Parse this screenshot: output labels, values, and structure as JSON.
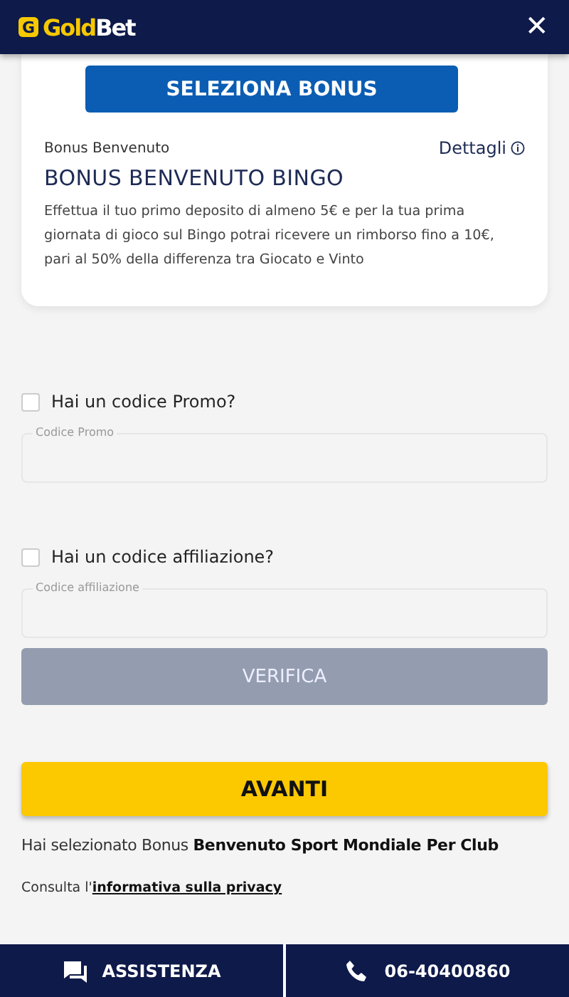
{
  "header": {
    "logo_badge": "G",
    "logo": [
      "Gold",
      "Bet"
    ],
    "close": "✕"
  },
  "bonus_card": {
    "button": "SELEZIONA BONUS",
    "category": "Bonus Benvenuto",
    "details_link": "Dettagli",
    "title": "BONUS BENVENUTO BINGO",
    "description": "Effettua il tuo primo deposito di almeno 5€ e per la tua prima giornata di gioco sul Bingo potrai ricevere un rimborso fino a 10€, pari al 50% della differenza tra Giocato e Vinto"
  },
  "codes": [
    {
      "label": "Hai un codice Promo?",
      "checked": false,
      "field_label": "Codice Promo"
    },
    {
      "label": "Hai un codice affiliazione?",
      "checked": false,
      "field_label": "Codice affiliazione"
    }
  ],
  "verify_button": {
    "label": "VERIFICA",
    "disabled": true
  },
  "next_button": "AVANTI",
  "selection_note": "Hai selezionato Bonus **Benvenuto Sport Mondiale Per Club**",
  "privacy": {
    "text": "Consulta l'",
    "link": "informativa sulla privacy"
  },
  "footer": [
    {
      "kind": "chat",
      "label": "ASSISTENZA"
    },
    {
      "kind": "phone",
      "label": "06-40400860"
    }
  ]
}
